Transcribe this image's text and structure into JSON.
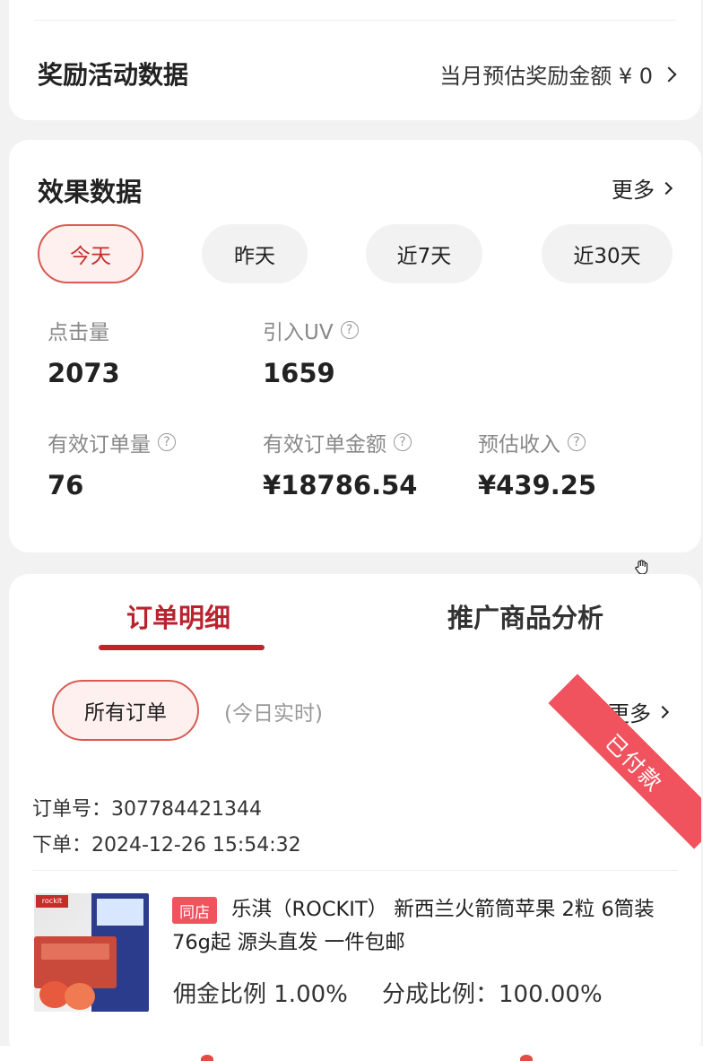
{
  "reward": {
    "title": "奖励活动数据",
    "estimate_label": "当月预估奖励金额 ¥ 0"
  },
  "stats": {
    "title": "效果数据",
    "more_label": "更多",
    "ranges": [
      "今天",
      "昨天",
      "近7天",
      "近30天"
    ],
    "active_range": "今天",
    "metrics": {
      "clicks": {
        "label": "点击量",
        "value": "2073"
      },
      "uv": {
        "label": "引入UV",
        "value": "1659"
      },
      "valid_orders": {
        "label": "有效订单量",
        "value": "76"
      },
      "valid_amount": {
        "label": "有效订单金额",
        "value": "¥18786.54"
      },
      "est_income": {
        "label": "预估收入",
        "value": "¥439.25"
      }
    },
    "help_glyph": "?"
  },
  "orders": {
    "tabs": [
      "订单明细",
      "推广商品分析"
    ],
    "active_tab": "订单明细",
    "filter_label": "所有订单",
    "realtime_label": "(今日实时)",
    "more_label": "更多",
    "order": {
      "status": "已付款",
      "order_no": "订单号：307784421344",
      "order_time": "下单：2024-12-26 15:54:32",
      "shop_tag": "同店",
      "product_title": "乐淇（ROCKIT） 新西兰火箭筒苹果 2粒 6筒装 76g起 源头直发 一件包邮",
      "commission": "佣金比例 1.00%",
      "split": "分成比例：100.00%",
      "image_logo_text": "rockit"
    }
  },
  "colors": {
    "accent": "#c0232e",
    "ribbon": "#f0525e",
    "active_bg": "#fdf0ee",
    "page_bg": "#f2f2f2"
  }
}
